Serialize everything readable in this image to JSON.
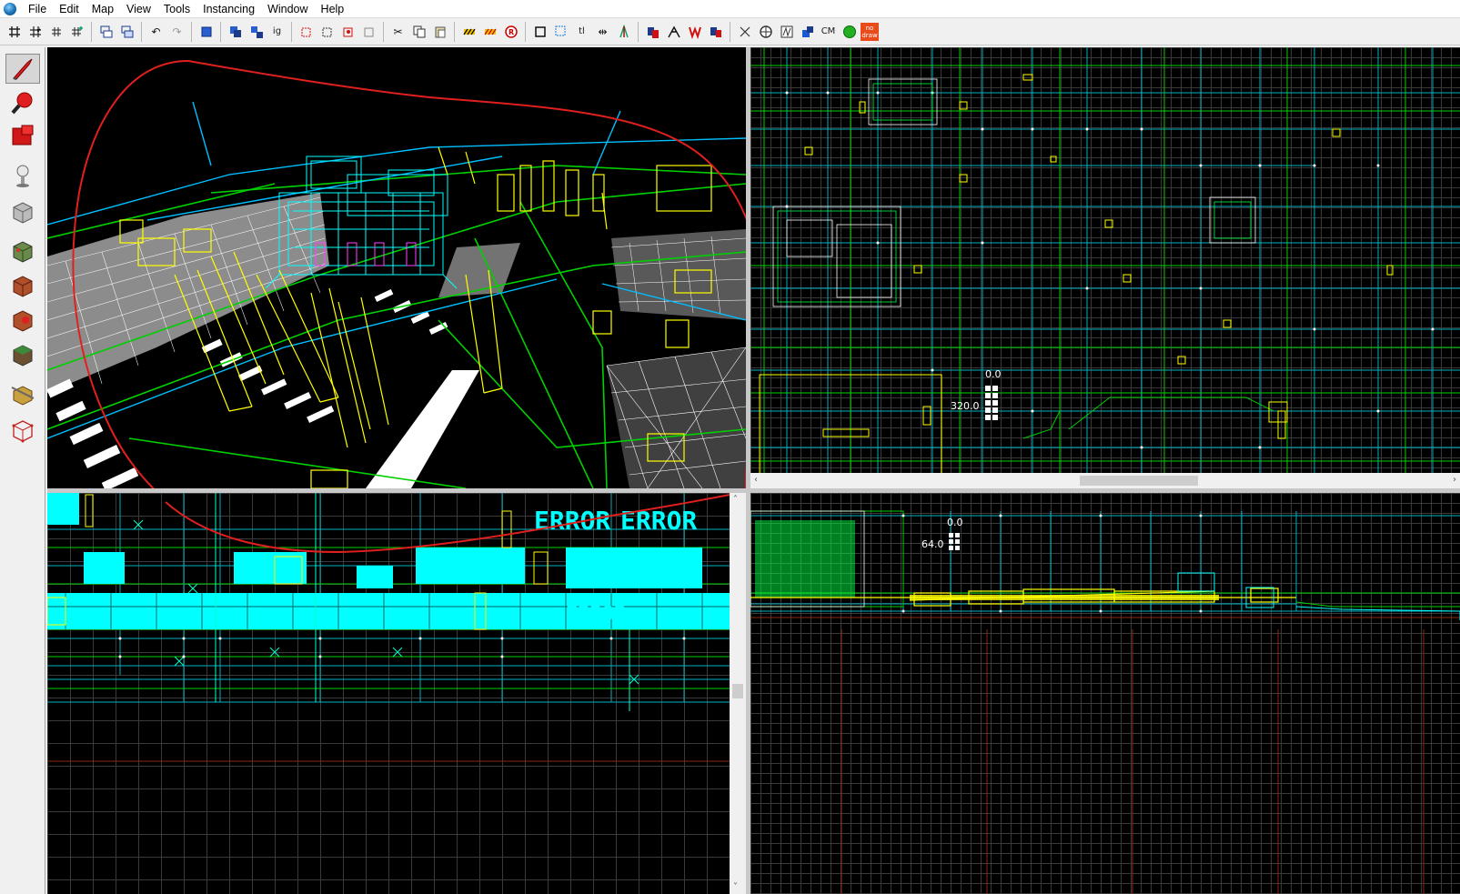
{
  "menu": {
    "items": [
      "File",
      "Edit",
      "Map",
      "View",
      "Tools",
      "Instancing",
      "Window",
      "Help"
    ]
  },
  "toolbar": {
    "buttons": [
      {
        "icon": "grid-toggle-icon"
      },
      {
        "icon": "grid-numbers-icon"
      },
      {
        "icon": "grid-smaller-icon"
      },
      {
        "icon": "grid-larger-icon"
      },
      {
        "icon": "load-window-state-icon"
      },
      {
        "icon": "save-window-state-icon"
      },
      {
        "icon": "undo-icon"
      },
      {
        "icon": "redo-icon"
      },
      {
        "icon": "carve-icon"
      },
      {
        "icon": "group-icon"
      },
      {
        "icon": "ungroup-icon"
      },
      {
        "icon": "ignore-groups-icon",
        "text": "ig"
      },
      {
        "icon": "hide-selected-icon"
      },
      {
        "icon": "hide-unselected-icon"
      },
      {
        "icon": "show-all-icon"
      },
      {
        "icon": "visgroup-icon"
      },
      {
        "icon": "cut-icon"
      },
      {
        "icon": "copy-icon"
      },
      {
        "icon": "paste-icon"
      },
      {
        "icon": "texture-lock-icon"
      },
      {
        "icon": "texture-scale-lock-icon"
      },
      {
        "icon": "replace-textures-icon"
      },
      {
        "icon": "toggle-select-handles-icon"
      },
      {
        "icon": "selection-box-icon"
      },
      {
        "icon": "toggle-texture-icon",
        "text": "tl"
      },
      {
        "icon": "flip-horizontal-icon"
      },
      {
        "icon": "flip-vertical-icon"
      },
      {
        "icon": "displacement-icon"
      },
      {
        "icon": "to-world-icon"
      },
      {
        "icon": "to-entity-icon"
      },
      {
        "icon": "move-to-world-icon"
      },
      {
        "icon": "clip-icon"
      },
      {
        "icon": "vertex-icon"
      },
      {
        "icon": "cordon-icon"
      },
      {
        "icon": "compile-icon"
      },
      {
        "icon": "cm-icon",
        "text": "CM"
      },
      {
        "icon": "green-ball-icon"
      },
      {
        "icon": "nodraw-icon",
        "text": "no draw"
      }
    ]
  },
  "tools": [
    {
      "name": "selection-tool",
      "icon": "pointer-icon",
      "active": true
    },
    {
      "name": "magnify-tool",
      "icon": "magnify-icon"
    },
    {
      "name": "camera-tool",
      "icon": "camera-icon"
    },
    {
      "name": "entity-tool",
      "icon": "entity-icon"
    },
    {
      "name": "block-tool",
      "icon": "block-icon"
    },
    {
      "name": "texture-application-tool",
      "icon": "texture-icon"
    },
    {
      "name": "apply-current-texture-tool",
      "icon": "apply-texture-icon"
    },
    {
      "name": "decal-tool",
      "icon": "decal-icon"
    },
    {
      "name": "overlay-tool",
      "icon": "overlay-icon"
    },
    {
      "name": "clipping-tool",
      "icon": "clip-icon"
    },
    {
      "name": "vertex-tool",
      "icon": "vertex-icon"
    }
  ],
  "views": {
    "top": {
      "coord_x": "0.0",
      "coord_y": "320.0"
    },
    "side": {
      "coord_x": "0.0",
      "coord_y": "64.0"
    },
    "front": {
      "labels": [
        "ERROR",
        "ERROR",
        "ERROR",
        "ERROR"
      ]
    }
  },
  "colors": {
    "annotation": "#e0201e",
    "brush_cyan": "#00c8ff",
    "brush_yellow": "#ffff00",
    "brush_green": "#00e000",
    "mesh_white": "#ffffff",
    "background": "#000000"
  }
}
